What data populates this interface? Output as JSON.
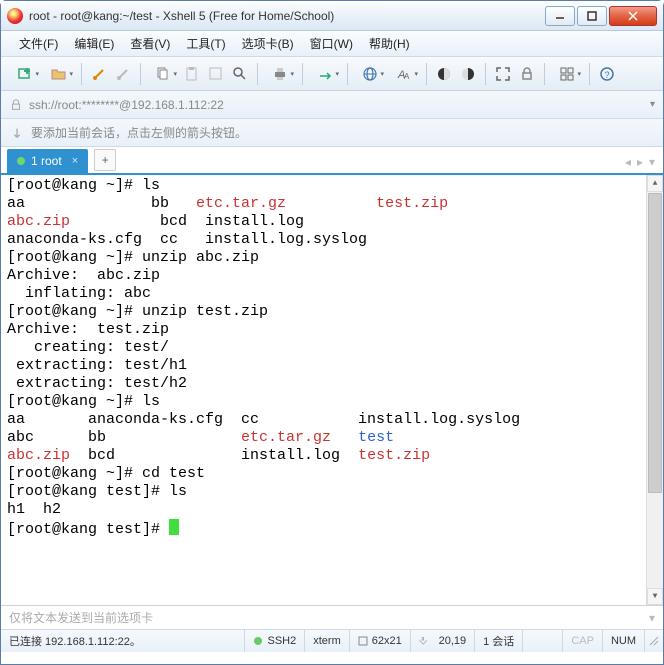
{
  "window": {
    "title": "root - root@kang:~/test - Xshell 5 (Free for Home/School)"
  },
  "menu": {
    "file": "文件(F)",
    "edit": "编辑(E)",
    "view": "查看(V)",
    "tools": "工具(T)",
    "tabs": "选项卡(B)",
    "window": "窗口(W)",
    "help": "帮助(H)"
  },
  "address": {
    "url": "ssh://root:********@192.168.1.112:22"
  },
  "infobar": {
    "text": "要添加当前会话，点击左侧的箭头按钮。"
  },
  "tab": {
    "label": "1 root",
    "add": "+"
  },
  "terminal": {
    "lines": [
      {
        "t": "prompt",
        "p": "[root@kang ~]# ",
        "cmd": "ls"
      },
      {
        "t": "ls1",
        "a": "aa",
        "b": "bb",
        "c": "etc.tar.gz",
        "d": "test.zip"
      },
      {
        "t": "ls2",
        "a": "abc.zip",
        "b": "bcd",
        "c": "install.log"
      },
      {
        "t": "ls3",
        "a": "anaconda-ks.cfg",
        "b": "cc",
        "c": "install.log.syslog"
      },
      {
        "t": "prompt",
        "p": "[root@kang ~]# ",
        "cmd": "unzip abc.zip"
      },
      {
        "t": "plain",
        "text": "Archive:  abc.zip"
      },
      {
        "t": "plain",
        "text": "  inflating: abc"
      },
      {
        "t": "prompt",
        "p": "[root@kang ~]# ",
        "cmd": "unzip test.zip"
      },
      {
        "t": "plain",
        "text": "Archive:  test.zip"
      },
      {
        "t": "plain",
        "text": "   creating: test/"
      },
      {
        "t": "plain",
        "text": " extracting: test/h1"
      },
      {
        "t": "plain",
        "text": " extracting: test/h2"
      },
      {
        "t": "prompt",
        "p": "[root@kang ~]# ",
        "cmd": "ls"
      },
      {
        "t": "ls4",
        "a": "aa",
        "b": "anaconda-ks.cfg",
        "c": "cc",
        "d": "install.log.syslog"
      },
      {
        "t": "ls5",
        "a": "abc",
        "b": "bb",
        "c": "etc.tar.gz",
        "d": "test"
      },
      {
        "t": "ls6",
        "a": "abc.zip",
        "b": "bcd",
        "c": "install.log",
        "d": "test.zip"
      },
      {
        "t": "prompt",
        "p": "[root@kang ~]# ",
        "cmd": "cd test"
      },
      {
        "t": "prompt",
        "p": "[root@kang test]# ",
        "cmd": "ls"
      },
      {
        "t": "plain",
        "text": "h1  h2"
      },
      {
        "t": "prompt-cursor",
        "p": "[root@kang test]# "
      }
    ]
  },
  "bottom_input": {
    "placeholder": "仅将文本发送到当前选项卡"
  },
  "status": {
    "conn": "已连接 192.168.1.112:22。",
    "ssh": "SSH2",
    "term": "xterm",
    "size": "62x21",
    "pos": "20,19",
    "sessions": "1 会话",
    "cap": "CAP",
    "num": "NUM"
  }
}
